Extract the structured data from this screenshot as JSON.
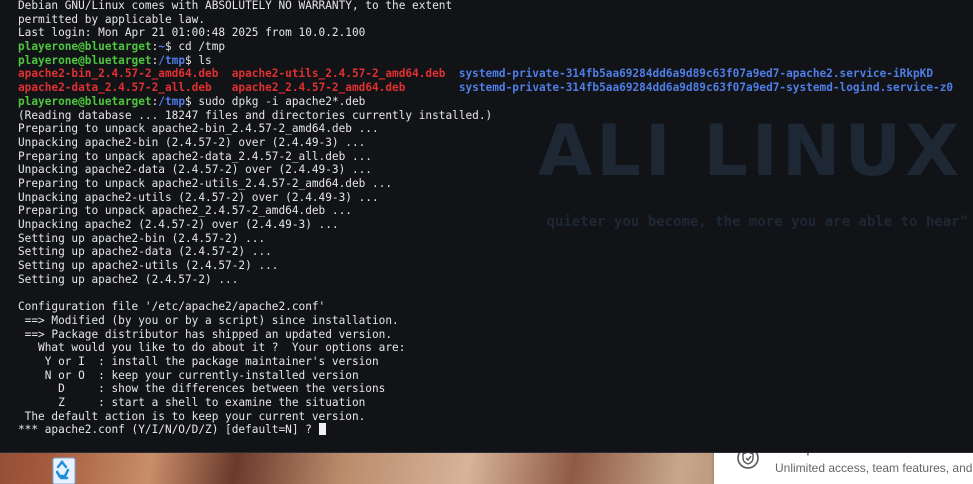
{
  "terminal": {
    "watermark_title": "ALI LINUX",
    "watermark_quote": "quieter you become, the more you are able to hear\"",
    "prompt_user": "playerone@bluetarget",
    "prompt_path": "/tmp",
    "lines": {
      "l0": "Debian GNU/Linux comes with ABSOLUTELY NO WARRANTY, to the extent",
      "l1": "permitted by applicable law.",
      "l2": "Last login: Mon Apr 21 01:00:48 2025 from 10.0.2.100",
      "l3_path": "~",
      "l3_cmd": " cd /tmp",
      "l4_cmd": " ls",
      "ls_row1": [
        "apache2-bin_2.4.57-2_amd64.deb",
        "apache2-utils_2.4.57-2_amd64.deb",
        "systemd-private-314fb5aa69284dd6a9d89c63f07a9ed7-apache2.service-iRkpKD"
      ],
      "ls_row2": [
        "apache2-data_2.4.57-2_all.deb",
        "apache2_2.4.57-2_amd64.deb",
        "systemd-private-314fb5aa69284dd6a9d89c63f07a9ed7-systemd-logind.service-z0"
      ],
      "l7_cmd": " sudo dpkg -i apache2*.deb",
      "l8": "(Reading database ... 18247 files and directories currently installed.)",
      "l9": "Preparing to unpack apache2-bin_2.4.57-2_amd64.deb ...",
      "l10": "Unpacking apache2-bin (2.4.57-2) over (2.4.49-3) ...",
      "l11": "Preparing to unpack apache2-data_2.4.57-2_all.deb ...",
      "l12": "Unpacking apache2-data (2.4.57-2) over (2.4.49-3) ...",
      "l13": "Preparing to unpack apache2-utils_2.4.57-2_amd64.deb ...",
      "l14": "Unpacking apache2-utils (2.4.57-2) over (2.4.49-3) ...",
      "l15": "Preparing to unpack apache2_2.4.57-2_amd64.deb ...",
      "l16": "Unpacking apache2 (2.4.57-2) over (2.4.49-3) ...",
      "l17": "Setting up apache2-bin (2.4.57-2) ...",
      "l18": "Setting up apache2-data (2.4.57-2) ...",
      "l19": "Setting up apache2-utils (2.4.57-2) ...",
      "l20": "Setting up apache2 (2.4.57-2) ...",
      "l21": "",
      "l22": "Configuration file '/etc/apache2/apache2.conf'",
      "l23": " ==> Modified (by you or by a script) since installation.",
      "l24": " ==> Package distributor has shipped an updated version.",
      "l25": "   What would you like to do about it ?  Your options are:",
      "l26": "    Y or I  : install the package maintainer's version",
      "l27": "    N or O  : keep your currently-installed version",
      "l28": "      D     : show the differences between the versions",
      "l29": "      Z     : start a shell to examine the situation",
      "l30": " The default action is to keep your current version.",
      "l31": "*** apache2.conf (Y/I/N/O/D/Z) [default=N] ? "
    }
  },
  "notification": {
    "icon": "vpn-shield-icon",
    "title": "View plans",
    "body": "Unlimited access, team features, and"
  },
  "desktop": {
    "icon": "recycle-bin-icon"
  },
  "colors": {
    "terminal_bg": "#111317",
    "prompt_user": "#4ec63f",
    "prompt_path": "#4f7ee6",
    "deb_file": "#e03030",
    "dir": "#4f7ee6",
    "text": "#e6e6e6"
  }
}
